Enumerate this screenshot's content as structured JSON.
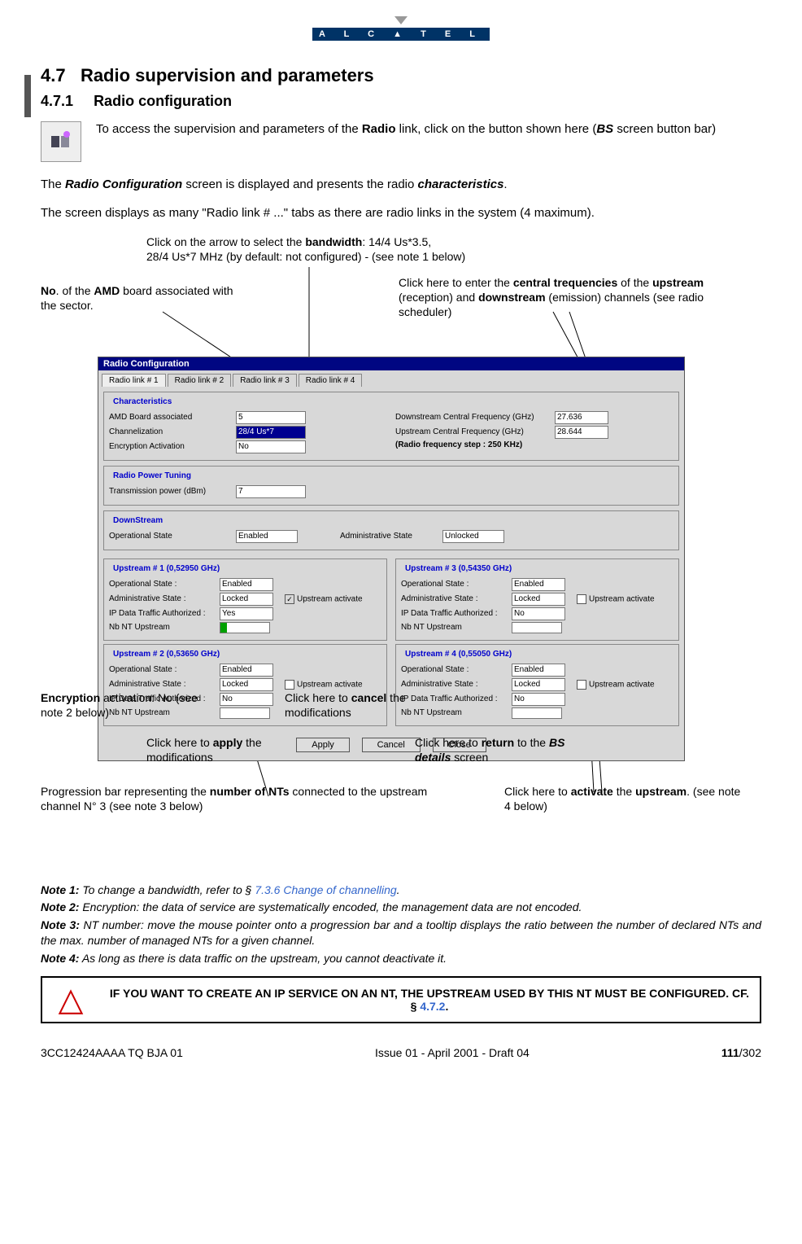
{
  "logo": "A L C ▲ T E L",
  "section_number": "4.7",
  "section_title": "Radio supervision and parameters",
  "subsection_number": "4.7.1",
  "subsection_title": "Radio configuration",
  "intro_p1_a": "To access the supervision and parameters of the ",
  "intro_p1_b": "Radio",
  "intro_p1_c": " link, click on the button shown here (",
  "intro_p1_d": "BS",
  "intro_p1_e": " screen button bar)",
  "para2_a": "The ",
  "para2_b": "Radio Configuration",
  "para2_c": " screen is displayed and presents the radio ",
  "para2_d": "characteristics",
  "para2_e": ".",
  "para3": "The screen displays as many \"Radio link # ...\" tabs as there are radio links in the system (4 maximum).",
  "call_bandwidth_a": "Click on the arrow to select the ",
  "call_bandwidth_b": "bandwidth",
  "call_bandwidth_c": ": 14/4 Us*3.5,",
  "call_bandwidth_line2": "28/4 Us*7 MHz (by default: not configured) - (see note 1 below)",
  "call_amd_a": "No",
  "call_amd_b": ". of the ",
  "call_amd_c": "AMD",
  "call_amd_d": " board associated with the sector.",
  "call_freq_a": "Click here to enter  the ",
  "call_freq_b": "central trequencies",
  "call_freq_c": " of the ",
  "call_freq_d": "upstream",
  "call_freq_e": " (reception) and ",
  "call_freq_f": "downstream",
  "call_freq_g": " (emission) channels (see radio scheduler)",
  "call_encrypt_a": "Encryption",
  "call_encrypt_b": " activation: No (see note 2 below)",
  "call_cancel_a": "Click here to ",
  "call_cancel_b": "cancel",
  "call_cancel_c": " the modifications",
  "call_apply_a": "Click here to ",
  "call_apply_b": "apply",
  "call_apply_c": " the modifications",
  "call_return_a": "Click here to ",
  "call_return_b": "return",
  "call_return_c": " to the ",
  "call_return_d": "BS details",
  "call_return_e": " screen",
  "call_prog_a": "Progression bar representing the ",
  "call_prog_b": "number of NTs",
  "call_prog_c": " connected to the upstream channel N° 3 (see note 3 below)",
  "call_activate_a": "Click here to ",
  "call_activate_b": "activate",
  "call_activate_c": " the ",
  "call_activate_d": "upstream",
  "call_activate_e": ". (see note 4 below)",
  "win": {
    "title": "Radio Configuration",
    "tabs": [
      "Radio link # 1",
      "Radio link # 2",
      "Radio link # 3",
      "Radio link # 4"
    ],
    "char_title": "Characteristics",
    "amd_lbl": "AMD Board associated",
    "amd_val": "5",
    "chan_lbl": "Channelization",
    "chan_val": "28/4 Us*7",
    "enc_lbl": "Encryption Activation",
    "enc_val": "No",
    "dcf_lbl": "Downstream Central Frequency (GHz)",
    "dcf_val": "27.636",
    "ucf_lbl": "Upstream Central Frequency (GHz)",
    "ucf_val": "28.644",
    "step_lbl": "(Radio frequency step : 250 KHz)",
    "rpt_title": "Radio Power Tuning",
    "tx_lbl": "Transmission power (dBm)",
    "tx_val": "7",
    "ds_title": "DownStream",
    "op_lbl": "Operational State",
    "op_val": "Enabled",
    "adm_lbl": "Administrative State",
    "adm_val": "Unlocked",
    "us": [
      {
        "title": "Upstream # 1 (0,52950 GHz)",
        "op": "Enabled",
        "adm": "Locked",
        "ip": "Yes",
        "chk": true,
        "prog": true
      },
      {
        "title": "Upstream # 2 (0,53650 GHz)",
        "op": "Enabled",
        "adm": "Locked",
        "ip": "No",
        "chk": false,
        "prog": false
      },
      {
        "title": "Upstream # 3 (0,54350 GHz)",
        "op": "Enabled",
        "adm": "Locked",
        "ip": "No",
        "chk": false,
        "prog": false
      },
      {
        "title": "Upstream # 4 (0,55050 GHz)",
        "op": "Enabled",
        "adm": "Locked",
        "ip": "No",
        "chk": false,
        "prog": false
      }
    ],
    "us_op_lbl": "Operational State :",
    "us_adm_lbl": "Administrative State :",
    "us_ip_lbl": "IP Data Traffic Authorized :",
    "us_nt_lbl": "Nb NT Upstream",
    "us_act_lbl": "Upstream activate",
    "btn_apply": "Apply",
    "btn_cancel": "Cancel",
    "btn_close": "Close"
  },
  "note1_lbl": "Note 1:",
  "note1_a": " To change a bandwidth, refer to § ",
  "note1_link": "7.3.6 Change of channelling",
  "note1_b": ".",
  "note2_lbl": "Note 2:",
  "note2": " Encryption: the data of service are systematically encoded, the management data are not encoded.",
  "note3_lbl": "Note 3:",
  "note3": " NT number: move the mouse pointer onto a progression bar and a tooltip displays the ratio between the number of declared NTs and the max. number of managed NTs for a given channel.",
  "note4_lbl": "Note 4:",
  "note4": " As long as there is data traffic on the upstream, you cannot deactivate it.",
  "warn_a": "IF YOU WANT TO CREATE AN IP SERVICE ON AN NT, THE UPSTREAM USED BY THIS NT MUST BE CONFIGURED. CF. § ",
  "warn_link": "4.7.2",
  "warn_b": ".",
  "foot_left": "3CC12424AAAA TQ BJA 01",
  "foot_center": "Issue 01 - April 2001 - Draft 04",
  "foot_pg_a": "111",
  "foot_pg_b": "/302"
}
